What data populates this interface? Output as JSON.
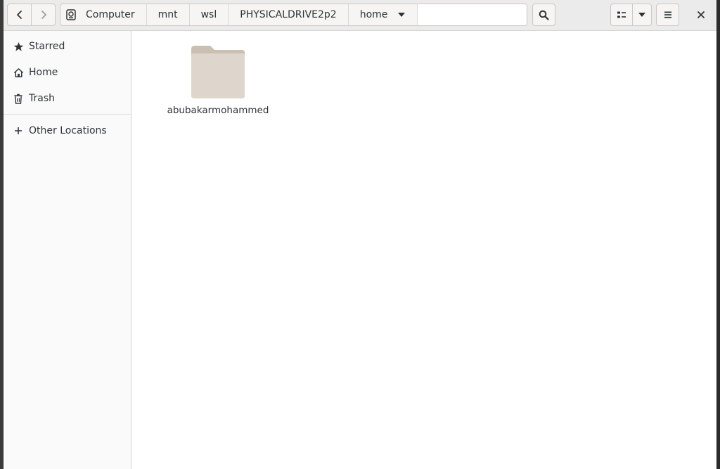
{
  "window": {
    "title": "home"
  },
  "toolbar": {
    "back_icon": "chevron-left-icon",
    "forward_icon": "chevron-right-icon",
    "search_icon": "search-icon",
    "view_icon": "list-view-icon",
    "view_menu_icon": "chevron-down-icon",
    "menu_icon": "hamburger-menu-icon",
    "close_icon": "close-icon"
  },
  "pathbar": {
    "crumbs": [
      {
        "label": "Computer",
        "icon": "drive-icon"
      },
      {
        "label": "mnt"
      },
      {
        "label": "wsl"
      },
      {
        "label": "PHYSICALDRIVE2p2"
      },
      {
        "label": "home",
        "current": true
      }
    ]
  },
  "sidebar": {
    "items": [
      {
        "label": "Starred",
        "icon": "star-icon"
      },
      {
        "label": "Home",
        "icon": "home-icon"
      },
      {
        "label": "Trash",
        "icon": "trash-icon"
      },
      {
        "label": "Other Locations",
        "icon": "plus-icon"
      }
    ]
  },
  "files": [
    {
      "name": "abubakarmohammed",
      "type": "folder"
    }
  ],
  "colors": {
    "folder_body": "#ded6cd",
    "folder_tab": "#cbbfb1",
    "headerbar": "#ebebeb",
    "sidebar": "#fafafa"
  }
}
